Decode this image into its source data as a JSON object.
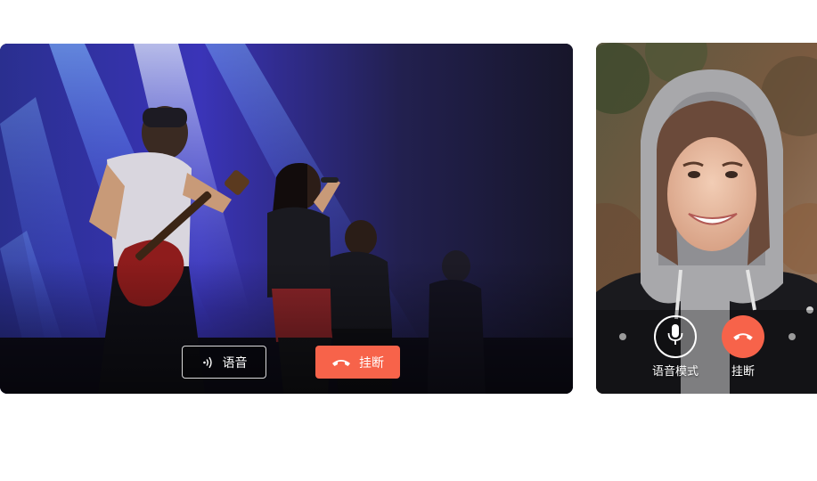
{
  "main_call": {
    "voice_button_label": "语音",
    "hangup_button_label": "挂断",
    "voice_icon": "sound-wave-icon",
    "hangup_icon": "phone-hangup-icon"
  },
  "side_call": {
    "voice_mode_label": "语音模式",
    "hangup_label": "挂断",
    "voice_mode_icon": "microphone-icon",
    "hangup_icon": "phone-hangup-icon"
  },
  "colors": {
    "hangup_red": "#f7634a",
    "white": "#ffffff"
  }
}
